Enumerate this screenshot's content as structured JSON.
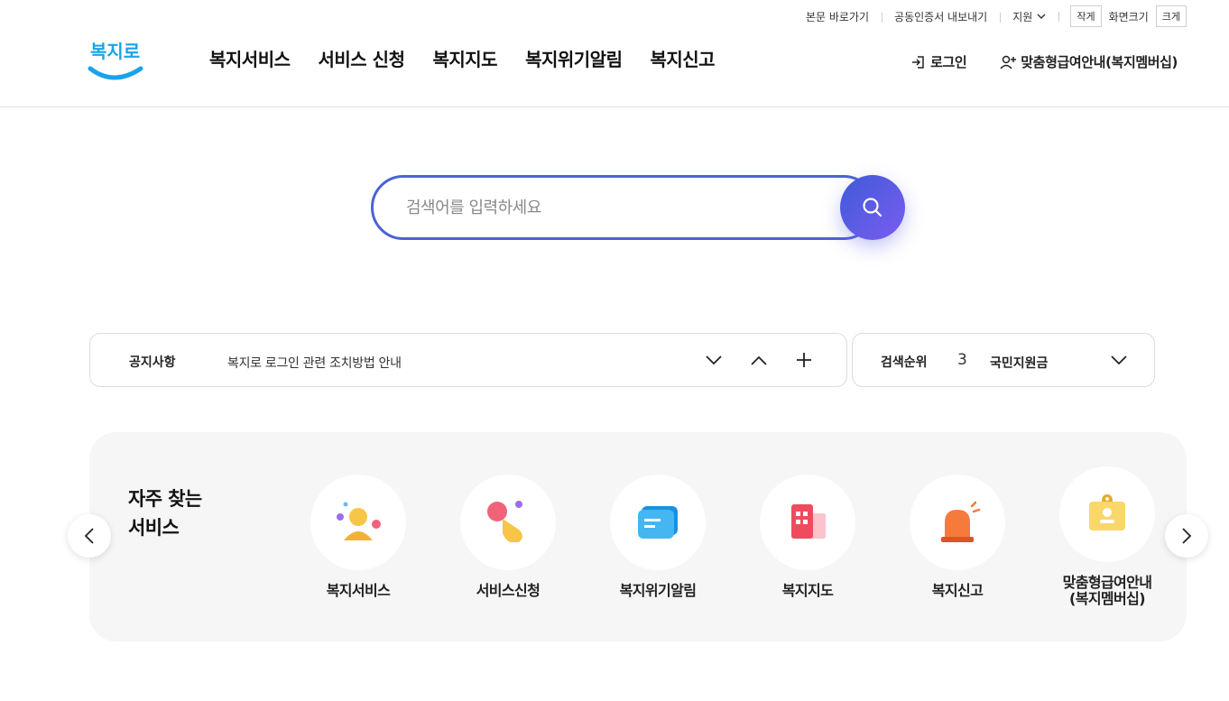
{
  "utility": {
    "skip_link": "본문 바로가기",
    "cert_export": "공동인증서 내보내기",
    "support": "지원",
    "size_small": "작게",
    "size_label": "화면크기",
    "size_large": "크게"
  },
  "logo": {
    "text": "복지로"
  },
  "nav": [
    {
      "label": "복지서비스"
    },
    {
      "label": "서비스 신청"
    },
    {
      "label": "복지지도"
    },
    {
      "label": "복지위기알림"
    },
    {
      "label": "복지신고"
    }
  ],
  "header_right": {
    "login": "로그인",
    "membership": "맞춤형급여안내(복지멤버십)"
  },
  "search": {
    "placeholder": "검색어를 입력하세요"
  },
  "notice": {
    "label": "공지사항",
    "text": "복지로 로그인 관련 조치방법 안내"
  },
  "ranking": {
    "label": "검색순위",
    "rank": "3",
    "keyword": "국민지원금"
  },
  "frequent": {
    "title_line1": "자주 찾는",
    "title_line2": "서비스",
    "items": [
      {
        "label": "복지서비스",
        "icon": "person-icon"
      },
      {
        "label": "서비스신청",
        "icon": "hand-tap-icon"
      },
      {
        "label": "복지위기알림",
        "icon": "chat-icon"
      },
      {
        "label": "복지지도",
        "icon": "map-building-icon"
      },
      {
        "label": "복지신고",
        "icon": "siren-icon"
      },
      {
        "label_line1": "맞춤형급여안내",
        "label_line2": "(복지멤버십)",
        "icon": "id-badge-icon"
      }
    ]
  },
  "colors": {
    "brand": "#4b63d6",
    "accent": "#7b5cf1",
    "logo_blue": "#1aa3e8"
  }
}
